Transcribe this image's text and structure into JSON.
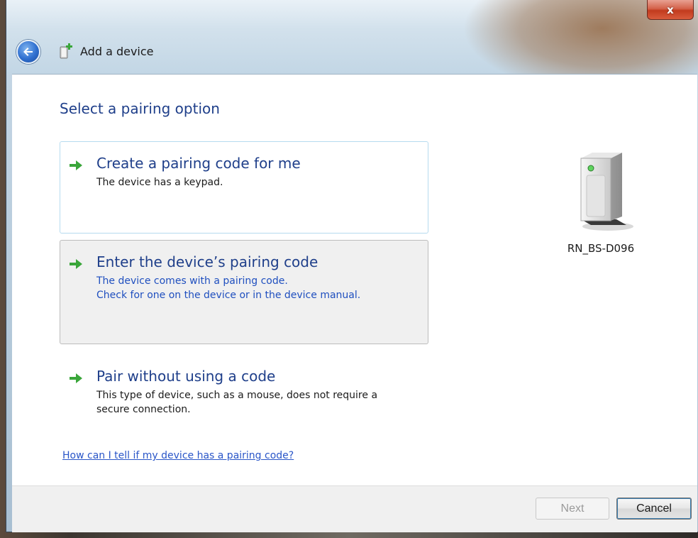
{
  "window": {
    "title": "Add a device",
    "close_label": "x"
  },
  "main": {
    "heading": "Select a pairing option",
    "options": [
      {
        "title": "Create a pairing code for me",
        "description": "The device has a keypad."
      },
      {
        "title": "Enter the device’s pairing code",
        "description_line1": "The device comes with a pairing code.",
        "description_line2": "Check for one on the device or in the device manual."
      },
      {
        "title": "Pair without using a code",
        "description_line1": "This type of device, such as a mouse, does not require a",
        "description_line2": "secure connection."
      }
    ],
    "device_name": "RN_BS-D096",
    "help_link": "How can I tell if my device has a pairing code?"
  },
  "footer": {
    "next_label": "Next",
    "cancel_label": "Cancel"
  },
  "colors": {
    "heading_blue": "#1f3f8a",
    "link_blue": "#2a56c8",
    "arrow_green": "#3aa63a",
    "selected_border": "#b6dbef"
  },
  "icons": {
    "back": "back-arrow-icon",
    "title": "add-device-icon",
    "option_arrow": "green-arrow-icon",
    "device": "device-tower-icon"
  }
}
